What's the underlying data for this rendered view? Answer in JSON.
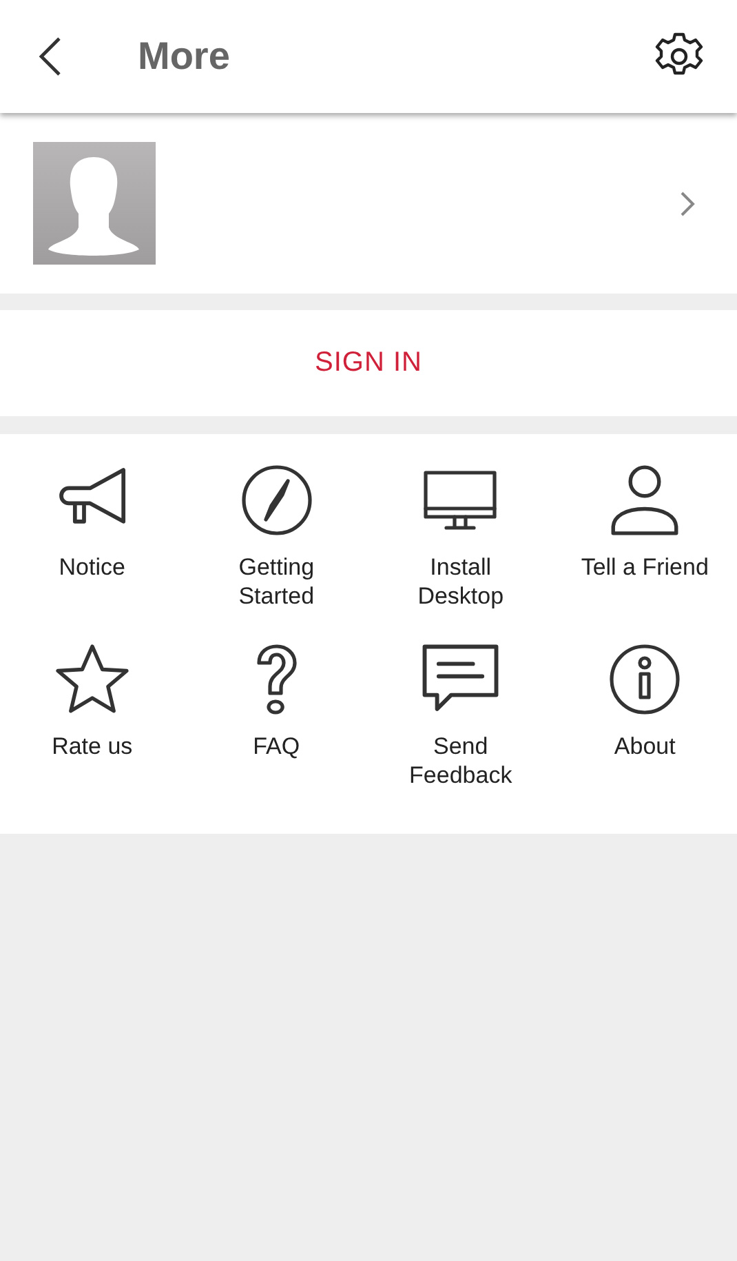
{
  "header": {
    "title": "More"
  },
  "sign_in": {
    "label": "SIGN IN"
  },
  "menu": [
    {
      "label": "Notice"
    },
    {
      "label": "Getting\nStarted"
    },
    {
      "label": "Install\nDesktop"
    },
    {
      "label": "Tell a Friend"
    },
    {
      "label": "Rate us"
    },
    {
      "label": "FAQ"
    },
    {
      "label": "Send\nFeedback"
    },
    {
      "label": "About"
    }
  ]
}
